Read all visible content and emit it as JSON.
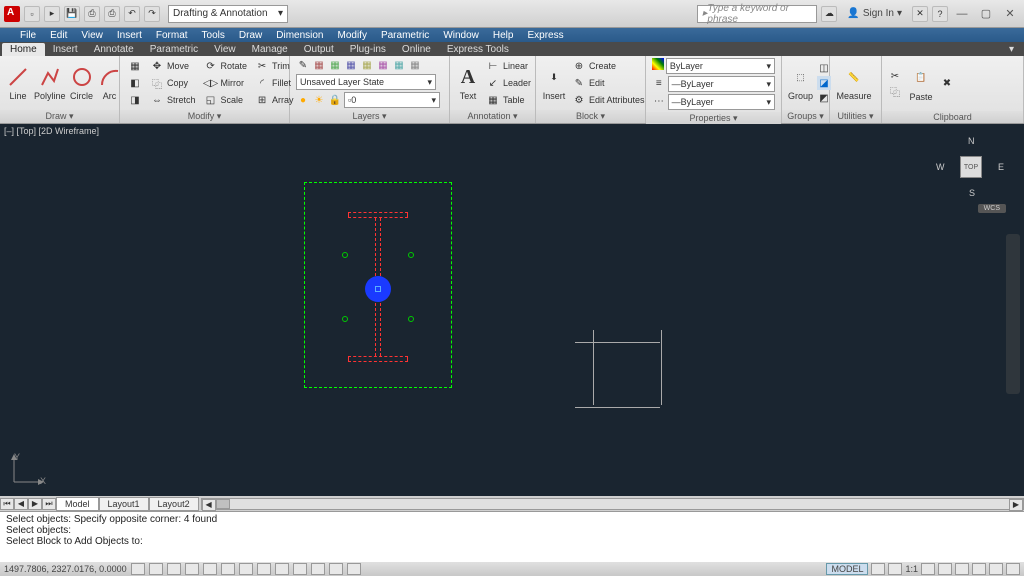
{
  "workspace": "Drafting & Annotation",
  "search_placeholder": "Type a keyword or phrase",
  "signin": "Sign In",
  "menubar": [
    "File",
    "Edit",
    "View",
    "Insert",
    "Format",
    "Tools",
    "Draw",
    "Dimension",
    "Modify",
    "Parametric",
    "Window",
    "Help",
    "Express"
  ],
  "ribbontabs": [
    "Home",
    "Insert",
    "Annotate",
    "Parametric",
    "View",
    "Manage",
    "Output",
    "Plug-ins",
    "Online",
    "Express Tools"
  ],
  "ribbon": {
    "draw": {
      "title": "Draw ▾",
      "line": "Line",
      "polyline": "Polyline",
      "circle": "Circle",
      "arc": "Arc"
    },
    "modify": {
      "title": "Modify ▾",
      "move": "Move",
      "rotate": "Rotate",
      "trim": "Trim",
      "copy": "Copy",
      "mirror": "Mirror",
      "fillet": "Fillet",
      "stretch": "Stretch",
      "scale": "Scale",
      "array": "Array"
    },
    "layers": {
      "title": "Layers ▾",
      "state": "Unsaved Layer State",
      "current": "0"
    },
    "annotation": {
      "title": "Annotation ▾",
      "text": "Text",
      "linear": "Linear",
      "leader": "Leader",
      "table": "Table"
    },
    "block": {
      "title": "Block ▾",
      "insert": "Insert",
      "create": "Create",
      "edit": "Edit",
      "edit_attr": "Edit Attributes"
    },
    "properties": {
      "title": "Properties ▾",
      "bylayer": "ByLayer"
    },
    "groups": {
      "title": "Groups ▾",
      "group": "Group"
    },
    "utilities": {
      "title": "Utilities ▾",
      "measure": "Measure"
    },
    "clipboard": {
      "title": "Clipboard",
      "paste": "Paste"
    }
  },
  "viewport_label": "[–] [Top] [2D Wireframe]",
  "viewcube": {
    "top": "TOP",
    "n": "N",
    "s": "S",
    "e": "E",
    "w": "W",
    "wcs": "WCS"
  },
  "layout_tabs": {
    "model": "Model",
    "l1": "Layout1",
    "l2": "Layout2"
  },
  "command_lines": [
    "Select objects: Specify opposite corner: 4 found",
    "Select objects:",
    "",
    "Select Block to Add Objects to:"
  ],
  "status": {
    "coords": "1497.7806, 2327.0176, 0.0000",
    "model": "MODEL",
    "scale": "1:1"
  }
}
